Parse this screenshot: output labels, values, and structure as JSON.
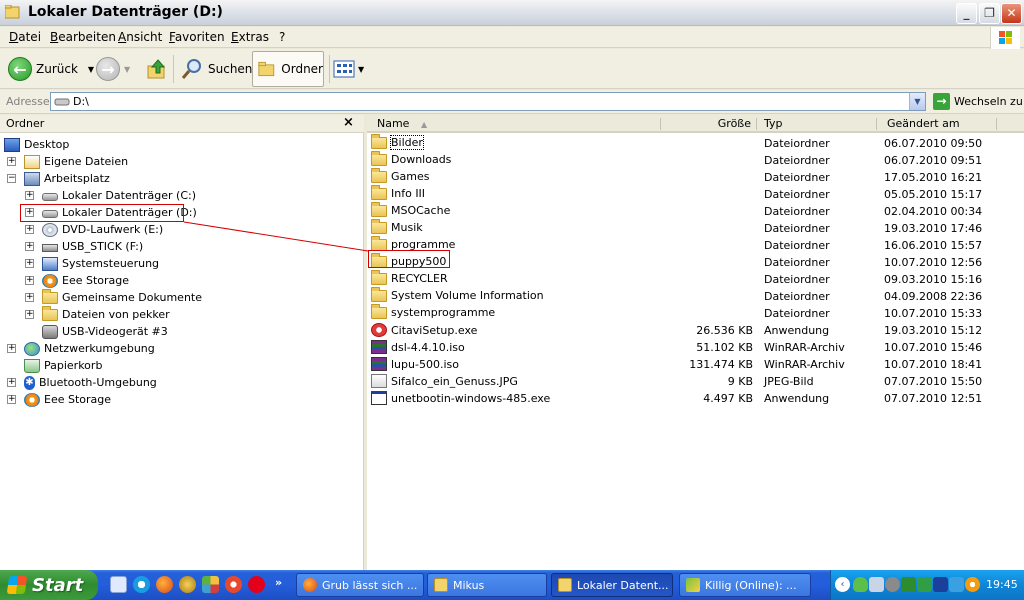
{
  "window": {
    "title": "Lokaler Datenträger (D:)"
  },
  "menu": {
    "items": [
      "Datei",
      "Bearbeiten",
      "Ansicht",
      "Favoriten",
      "Extras",
      "?"
    ]
  },
  "toolbar": {
    "back_label": "Zurück",
    "search_label": "Suchen",
    "folders_label": "Ordner"
  },
  "address": {
    "label": "Adresse",
    "value": "D:\\",
    "go_label": "Wechseln zu"
  },
  "folder_pane": {
    "title": "Ordner",
    "close": "×",
    "tree": [
      {
        "label": "Desktop",
        "icon": "desktop-icon",
        "level": 0,
        "expander": ""
      },
      {
        "label": "Eigene Dateien",
        "icon": "documents-icon",
        "level": 1,
        "expander": "+"
      },
      {
        "label": "Arbeitsplatz",
        "icon": "computer-icon",
        "level": 1,
        "expander": "−"
      },
      {
        "label": "Lokaler Datenträger (C:)",
        "icon": "drive-icon",
        "level": 2,
        "expander": "+"
      },
      {
        "label": "Lokaler Datenträger (D:)",
        "icon": "drive-icon",
        "level": 2,
        "expander": "+"
      },
      {
        "label": "DVD-Laufwerk (E:)",
        "icon": "dvd-drive-icon",
        "level": 2,
        "expander": "+"
      },
      {
        "label": "USB_STICK (F:)",
        "icon": "usb-drive-icon",
        "level": 2,
        "expander": "+"
      },
      {
        "label": "Systemsteuerung",
        "icon": "control-panel-icon",
        "level": 2,
        "expander": "+"
      },
      {
        "label": "Eee Storage",
        "icon": "eee-storage-icon",
        "level": 2,
        "expander": "+"
      },
      {
        "label": "Gemeinsame Dokumente",
        "icon": "folder-icon",
        "level": 2,
        "expander": "+"
      },
      {
        "label": "Dateien von pekker",
        "icon": "folder-icon",
        "level": 2,
        "expander": "+"
      },
      {
        "label": "USB-Videogerät #3",
        "icon": "camera-icon",
        "level": 2,
        "expander": ""
      },
      {
        "label": "Netzwerkumgebung",
        "icon": "network-icon",
        "level": 1,
        "expander": "+"
      },
      {
        "label": "Papierkorb",
        "icon": "recycle-bin-icon",
        "level": 1,
        "expander": ""
      },
      {
        "label": "Bluetooth-Umgebung",
        "icon": "bluetooth-icon",
        "level": 1,
        "expander": "+"
      },
      {
        "label": "Eee Storage",
        "icon": "eee-storage-icon",
        "level": 1,
        "expander": "+"
      }
    ]
  },
  "file_list": {
    "columns": {
      "name": "Name",
      "size": "Größe",
      "type": "Typ",
      "modified": "Geändert am"
    },
    "rows": [
      {
        "name": "Bilder",
        "size": "",
        "type": "Dateiordner",
        "modified": "06.07.2010 09:50",
        "icon": "folder-icon"
      },
      {
        "name": "Downloads",
        "size": "",
        "type": "Dateiordner",
        "modified": "06.07.2010 09:51",
        "icon": "folder-icon"
      },
      {
        "name": "Games",
        "size": "",
        "type": "Dateiordner",
        "modified": "17.05.2010 16:21",
        "icon": "folder-icon"
      },
      {
        "name": "Info III",
        "size": "",
        "type": "Dateiordner",
        "modified": "05.05.2010 15:17",
        "icon": "folder-icon"
      },
      {
        "name": "MSOCache",
        "size": "",
        "type": "Dateiordner",
        "modified": "02.04.2010 00:34",
        "icon": "folder-icon"
      },
      {
        "name": "Musik",
        "size": "",
        "type": "Dateiordner",
        "modified": "19.03.2010 17:46",
        "icon": "folder-icon"
      },
      {
        "name": "programme",
        "size": "",
        "type": "Dateiordner",
        "modified": "16.06.2010 15:57",
        "icon": "folder-icon"
      },
      {
        "name": "puppy500",
        "size": "",
        "type": "Dateiordner",
        "modified": "10.07.2010 12:56",
        "icon": "folder-icon"
      },
      {
        "name": "RECYCLER",
        "size": "",
        "type": "Dateiordner",
        "modified": "09.03.2010 15:16",
        "icon": "folder-icon"
      },
      {
        "name": "System Volume Information",
        "size": "",
        "type": "Dateiordner",
        "modified": "04.09.2008 22:36",
        "icon": "folder-icon"
      },
      {
        "name": "systemprogramme",
        "size": "",
        "type": "Dateiordner",
        "modified": "10.07.2010 15:33",
        "icon": "folder-icon"
      },
      {
        "name": "CitaviSetup.exe",
        "size": "26.536 KB",
        "type": "Anwendung",
        "modified": "19.03.2010 15:12",
        "icon": "setup-exe-icon"
      },
      {
        "name": "dsl-4.4.10.iso",
        "size": "51.102 KB",
        "type": "WinRAR-Archiv",
        "modified": "10.07.2010 15:46",
        "icon": "winrar-icon"
      },
      {
        "name": "lupu-500.iso",
        "size": "131.474 KB",
        "type": "WinRAR-Archiv",
        "modified": "10.07.2010 18:41",
        "icon": "winrar-icon"
      },
      {
        "name": "Sifalco_ein_Genuss.JPG",
        "size": "9 KB",
        "type": "JPEG-Bild",
        "modified": "07.07.2010 15:50",
        "icon": "jpeg-icon"
      },
      {
        "name": "unetbootin-windows-485.exe",
        "size": "4.497 KB",
        "type": "Anwendung",
        "modified": "07.07.2010 12:51",
        "icon": "application-icon"
      }
    ]
  },
  "taskbar": {
    "start_label": "Start",
    "tasks": [
      {
        "label": "Grub lässt sich ...",
        "icon": "firefox-icon"
      },
      {
        "label": "Mikus",
        "icon": "folder-icon"
      },
      {
        "label": "Lokaler Datent...",
        "icon": "folder-icon"
      },
      {
        "label": "Killig (Online): ...",
        "icon": "chat-icon"
      }
    ],
    "clock": "19:45"
  },
  "colors": {
    "highlight_red": "#d40000",
    "taskbar_blue": "#245edb",
    "start_green": "#3c9b3c"
  }
}
